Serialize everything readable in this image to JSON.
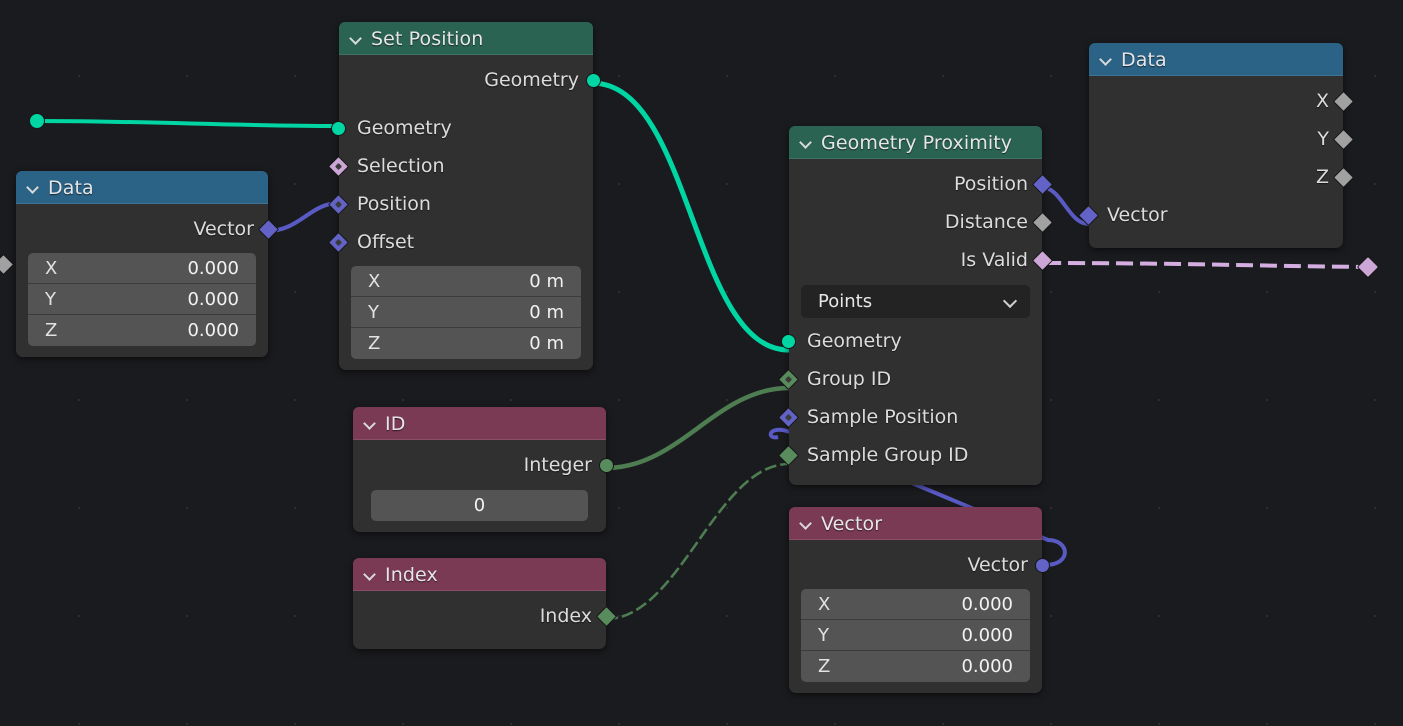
{
  "app": "blender-geometry-node-editor",
  "canvas": {
    "background_color": "#1a1b1e",
    "grid_dot_color": "#2c2d31"
  },
  "socket_colors": {
    "geometry": "#00d6a3",
    "vector": "#6363c7",
    "boolean": "#cca6d6",
    "float": "#a1a1a1",
    "integer": "#598c5c"
  },
  "header_colors": {
    "geometry": "#2b6352",
    "input": "#7a3a54",
    "data": "#2b6387"
  },
  "nodes": {
    "data_left": {
      "title": "Data",
      "outputs": [
        {
          "label": "Vector",
          "type": "vector"
        }
      ],
      "fields": [
        {
          "name": "X",
          "value": "0.000"
        },
        {
          "name": "Y",
          "value": "0.000"
        },
        {
          "name": "Z",
          "value": "0.000"
        }
      ]
    },
    "set_position": {
      "title": "Set Position",
      "outputs": [
        {
          "label": "Geometry",
          "type": "geometry"
        }
      ],
      "inputs": [
        {
          "label": "Geometry",
          "type": "geometry"
        },
        {
          "label": "Selection",
          "type": "boolean"
        },
        {
          "label": "Position",
          "type": "vector"
        },
        {
          "label": "Offset",
          "type": "vector"
        }
      ],
      "fields": [
        {
          "name": "X",
          "value": "0 m"
        },
        {
          "name": "Y",
          "value": "0 m"
        },
        {
          "name": "Z",
          "value": "0 m"
        }
      ]
    },
    "id": {
      "title": "ID",
      "outputs": [
        {
          "label": "Integer",
          "type": "integer"
        }
      ],
      "value": "0"
    },
    "index": {
      "title": "Index",
      "outputs": [
        {
          "label": "Index",
          "type": "integer"
        }
      ]
    },
    "geometry_proximity": {
      "title": "Geometry Proximity",
      "outputs": [
        {
          "label": "Position",
          "type": "vector"
        },
        {
          "label": "Distance",
          "type": "float"
        },
        {
          "label": "Is Valid",
          "type": "boolean"
        }
      ],
      "dropdown": {
        "value": "Points"
      },
      "inputs": [
        {
          "label": "Geometry",
          "type": "geometry"
        },
        {
          "label": "Group ID",
          "type": "integer"
        },
        {
          "label": "Sample Position",
          "type": "vector"
        },
        {
          "label": "Sample Group ID",
          "type": "integer"
        }
      ]
    },
    "vector": {
      "title": "Vector",
      "outputs": [
        {
          "label": "Vector",
          "type": "vector"
        }
      ],
      "fields": [
        {
          "name": "X",
          "value": "0.000"
        },
        {
          "name": "Y",
          "value": "0.000"
        },
        {
          "name": "Z",
          "value": "0.000"
        }
      ]
    },
    "data_right": {
      "title": "Data",
      "outputs": [
        {
          "label": "X",
          "type": "float"
        },
        {
          "label": "Y",
          "type": "float"
        },
        {
          "label": "Z",
          "type": "float"
        }
      ],
      "inputs": [
        {
          "label": "Vector",
          "type": "vector"
        }
      ]
    }
  }
}
